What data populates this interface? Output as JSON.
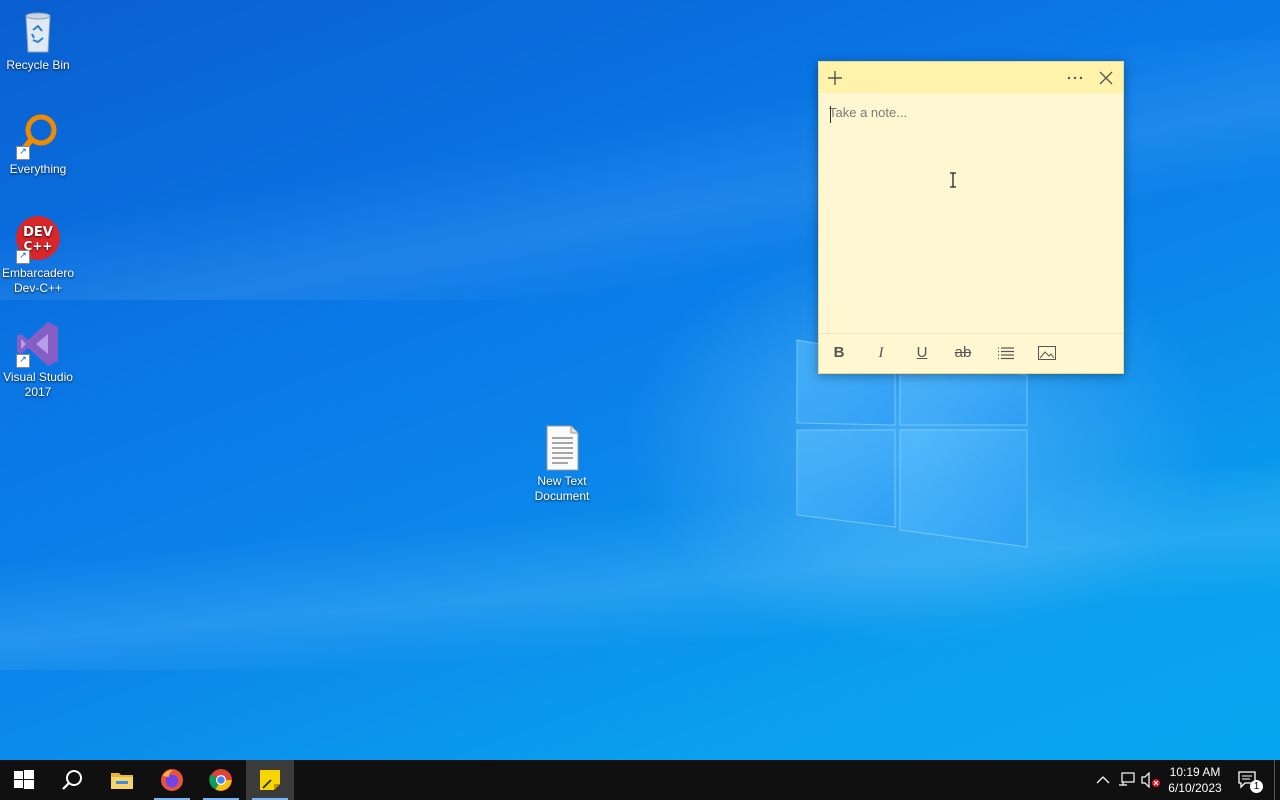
{
  "desktop": {
    "icons": [
      {
        "label": "Recycle Bin"
      },
      {
        "label": "Everything"
      },
      {
        "label": "Embarcadero Dev-C++"
      },
      {
        "label": "Visual Studio 2017"
      },
      {
        "label": "New Text Document"
      }
    ]
  },
  "sticky_note": {
    "placeholder": "Take a note...",
    "value": "",
    "colors": {
      "header": "#fff2ab",
      "body": "#fff7d1"
    },
    "header_buttons": [
      "add-icon",
      "more-icon",
      "close-icon"
    ],
    "toolbar": [
      "bold-icon",
      "italic-icon",
      "underline-icon",
      "strikethrough-icon",
      "bullets-icon",
      "image-icon"
    ],
    "toolbar_glyphs": {
      "bold": "B",
      "italic": "I",
      "underline": "U",
      "strike": "ab"
    }
  },
  "taskbar": {
    "pinned": [
      "start-icon",
      "search-icon",
      "file-explorer-icon",
      "firefox-icon",
      "chrome-icon",
      "sticky-notes-icon"
    ],
    "clock": {
      "time": "10:19 AM",
      "date": "6/10/2023"
    },
    "notifications_count": "1"
  }
}
